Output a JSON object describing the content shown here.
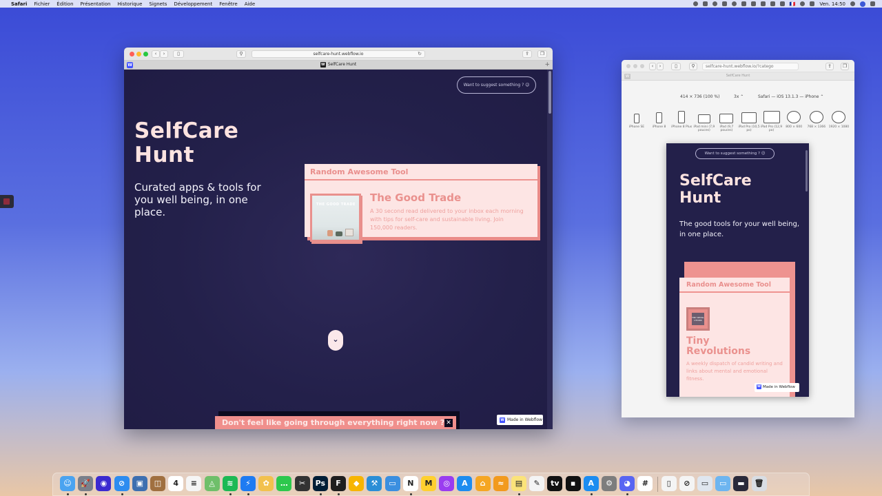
{
  "menubar": {
    "app_name": "Safari",
    "menus": [
      "Fichier",
      "Édition",
      "Présentation",
      "Historique",
      "Signets",
      "Développement",
      "Fenêtre",
      "Aide"
    ],
    "clock": "Ven. 14:50",
    "flag": "🇫🇷"
  },
  "main_window": {
    "url": "selfcare-hunt.webflow.io",
    "tab_title": "SelfCare Hunt",
    "tab_favicon_letter": "W",
    "page": {
      "suggest_button": "Want to suggest something ? 😉",
      "title_line1": "SelfCare",
      "title_line2": "Hunt",
      "subtitle": "Curated apps & tools for you well being, in one place.",
      "card": {
        "heading": "Random Awesome Tool",
        "thumb_text": "THE GOOD TRADE",
        "tool_name": "The Good Trade",
        "tool_desc": "A 30 second read delivered to your inbox each morning with tips for self-care and sustainable living. Join 150,000 readers."
      },
      "scroll_down": "⌄",
      "banner_text": "Don't feel like going through everything right now ?",
      "banner_close": "✕",
      "made_in_webflow": "Made in Webflow"
    }
  },
  "responsive_window": {
    "url": "selfcare-hunt.webflow.io/?catego",
    "tab_title": "SelfCare Hunt",
    "viewport": "414 × 736",
    "zoom_pct": "(100 %)",
    "scale": "3x ⌃",
    "user_agent": "Safari — iOS 13.1.3 — iPhone ⌃",
    "devices": [
      {
        "label": "iPhone SE",
        "w": 8,
        "h": 14
      },
      {
        "label": "iPhone 8",
        "w": 9,
        "h": 16
      },
      {
        "label": "iPhone 8 Plus",
        "w": 10,
        "h": 18
      },
      {
        "label": "iPad mini (7,9 pouces)",
        "w": 18,
        "h": 13
      },
      {
        "label": "iPad (9,7 pouces)",
        "w": 20,
        "h": 14
      },
      {
        "label": "iPad Pro (10,5 po)",
        "w": 22,
        "h": 16
      },
      {
        "label": "iPad Pro (12,9 po)",
        "w": 24,
        "h": 18
      },
      {
        "label": "800 × 600",
        "w": 20,
        "h": 18
      },
      {
        "label": "768 × 1366",
        "w": 20,
        "h": 18
      },
      {
        "label": "1920 × 1080",
        "w": 20,
        "h": 18
      }
    ],
    "phone": {
      "suggest_button": "Want to suggest something ? 😉",
      "title_line1": "SelfCare",
      "title_line2": "Hunt",
      "subtitle": "The good tools for your well being, in one place.",
      "card_heading": "Random Awesome Tool",
      "thumb_text": "TINY REVOL UTIONS",
      "tool_name_line1": "Tiny",
      "tool_name_line2": "Revolutions",
      "tool_desc": "A weekly dispatch of candid writing and links about mental and emotional fitness.",
      "made_in_webflow": "Made in Webflow"
    }
  },
  "dock": {
    "apps": [
      {
        "name": "finder",
        "color": "#4aa3f0",
        "glyph": "☺"
      },
      {
        "name": "launchpad",
        "color": "#7a7f8a",
        "glyph": "🚀"
      },
      {
        "name": "siri",
        "color": "#3b2ad0",
        "glyph": "◉"
      },
      {
        "name": "safari",
        "color": "#2d8cf0",
        "glyph": "⊘"
      },
      {
        "name": "preview",
        "color": "#3d6fb0",
        "glyph": "▣"
      },
      {
        "name": "contacts",
        "color": "#a07040",
        "glyph": "◫"
      },
      {
        "name": "calendar",
        "color": "#ffffff",
        "glyph": "4"
      },
      {
        "name": "reminders",
        "color": "#f5f5f5",
        "glyph": "≡"
      },
      {
        "name": "maps",
        "color": "#6fbf6a",
        "glyph": "◬"
      },
      {
        "name": "spotify",
        "color": "#1db954",
        "glyph": "≋"
      },
      {
        "name": "messenger",
        "color": "#1e7bf2",
        "glyph": "⚡"
      },
      {
        "name": "photos",
        "color": "#f2c14e",
        "glyph": "✿"
      },
      {
        "name": "messages",
        "color": "#2dc84d",
        "glyph": "…"
      },
      {
        "name": "final-cut",
        "color": "#333333",
        "glyph": "✂"
      },
      {
        "name": "photoshop",
        "color": "#001e36",
        "glyph": "Ps"
      },
      {
        "name": "figma",
        "color": "#1e1e1e",
        "glyph": "F"
      },
      {
        "name": "sketch",
        "color": "#f7b500",
        "glyph": "◆"
      },
      {
        "name": "xcode",
        "color": "#2b8ed6",
        "glyph": "⚒"
      },
      {
        "name": "keynote",
        "color": "#3b8fe0",
        "glyph": "▭"
      },
      {
        "name": "notion",
        "color": "#ffffff",
        "glyph": "N"
      },
      {
        "name": "miro",
        "color": "#ffd02f",
        "glyph": "M"
      },
      {
        "name": "podcasts",
        "color": "#9a3cf0",
        "glyph": "◎"
      },
      {
        "name": "app-store",
        "color": "#1c8cf0",
        "glyph": "A"
      },
      {
        "name": "home",
        "color": "#f5a623",
        "glyph": "⌂"
      },
      {
        "name": "audible",
        "color": "#f29a1e",
        "glyph": "≈"
      },
      {
        "name": "notes",
        "color": "#fbe37a",
        "glyph": "▤"
      },
      {
        "name": "textedit",
        "color": "#f4f4f4",
        "glyph": "✎"
      },
      {
        "name": "apple-tv",
        "color": "#111111",
        "glyph": "tv"
      },
      {
        "name": "terminal",
        "color": "#111111",
        "glyph": "▪"
      },
      {
        "name": "app-store-badge",
        "color": "#1c8cf0",
        "glyph": "A"
      },
      {
        "name": "system-preferences",
        "color": "#7d7d7d",
        "glyph": "⚙"
      },
      {
        "name": "discord",
        "color": "#5865f2",
        "glyph": "◕"
      },
      {
        "name": "slack",
        "color": "#ffffff",
        "glyph": "#"
      },
      {
        "name": "document",
        "color": "#f4f4f4",
        "glyph": "▯"
      },
      {
        "name": "safari-doc",
        "color": "#f4f4f4",
        "glyph": "⊘"
      },
      {
        "name": "screenshot",
        "color": "#dfe6ef",
        "glyph": "▭"
      },
      {
        "name": "folder",
        "color": "#6db5f0",
        "glyph": "▭"
      },
      {
        "name": "screen-folder",
        "color": "#2a2a3a",
        "glyph": "▬"
      },
      {
        "name": "trash",
        "color": "#d8dde3",
        "glyph": "🗑"
      }
    ]
  }
}
